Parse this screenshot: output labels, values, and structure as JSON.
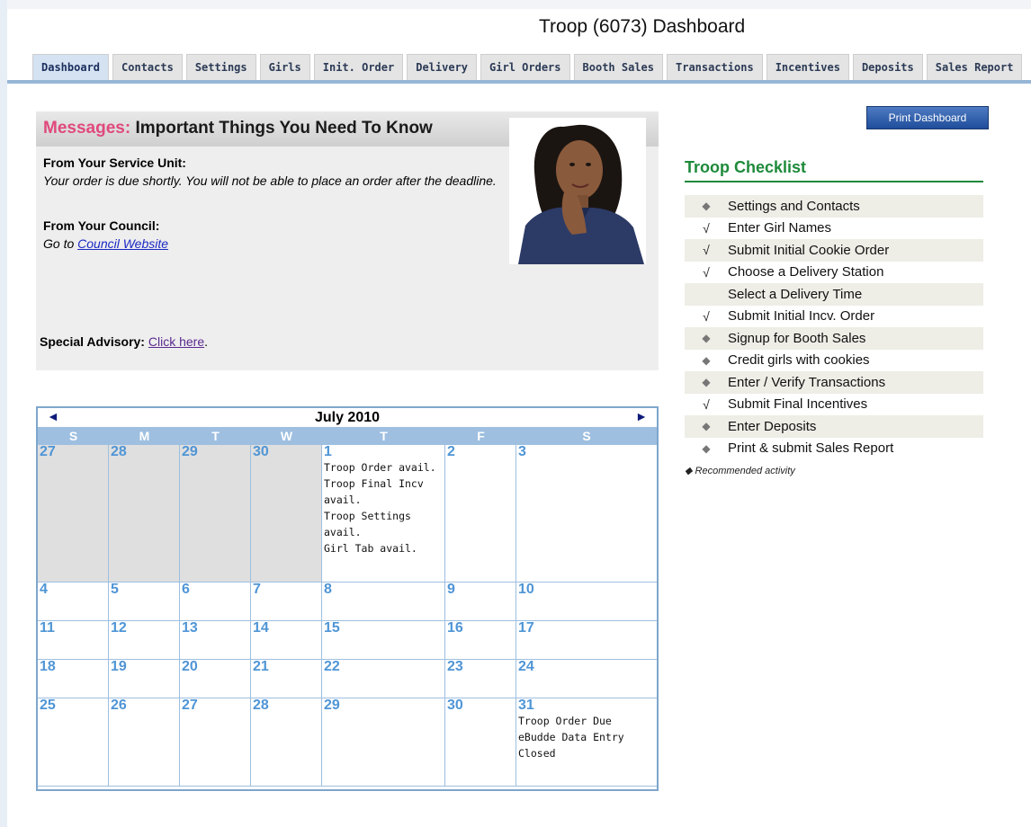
{
  "page_title": "Troop (6073) Dashboard",
  "tabs": [
    "Dashboard",
    "Contacts",
    "Settings",
    "Girls",
    "Init. Order",
    "Delivery",
    "Girl Orders",
    "Booth Sales",
    "Transactions",
    "Incentives",
    "Deposits",
    "Sales Report"
  ],
  "active_tab": "Dashboard",
  "messages": {
    "header_prefix": "Messages:",
    "header_rest": " Important Things You Need To Know",
    "service_unit_label": "From Your Service Unit:",
    "service_unit_text": "Your order is due shortly. You will not be able to place an order after the deadline.",
    "council_label": "From Your Council:",
    "council_prefix": "Go to ",
    "council_link": "Council Website",
    "advisory_label": "Special Advisory:",
    "advisory_link": "Click here",
    "advisory_suffix": "."
  },
  "print_button": "Print Dashboard",
  "checklist": {
    "title": "Troop Checklist",
    "items": [
      {
        "label": "Settings and Contacts",
        "mark": "diamond"
      },
      {
        "label": "Enter Girl Names",
        "mark": "check"
      },
      {
        "label": "Submit Initial Cookie Order",
        "mark": "check"
      },
      {
        "label": "Choose a Delivery Station",
        "mark": "check"
      },
      {
        "label": "Select a Delivery Time",
        "mark": "none"
      },
      {
        "label": "Submit Initial Incv. Order",
        "mark": "check"
      },
      {
        "label": "Signup for Booth Sales",
        "mark": "diamond"
      },
      {
        "label": "Credit girls with cookies",
        "mark": "diamond"
      },
      {
        "label": "Enter / Verify Transactions",
        "mark": "diamond"
      },
      {
        "label": "Submit Final Incentives",
        "mark": "check"
      },
      {
        "label": "Enter Deposits",
        "mark": "diamond"
      },
      {
        "label": "Print & submit Sales Report",
        "mark": "diamond"
      }
    ],
    "note": "◆ Recommended activity"
  },
  "calendar": {
    "month_label": "July 2010",
    "prev_icon": "◄",
    "next_icon": "►",
    "dow": [
      "S",
      "M",
      "T",
      "W",
      "T",
      "F",
      "S"
    ],
    "weeks": [
      [
        {
          "d": "27",
          "other": true
        },
        {
          "d": "28",
          "other": true
        },
        {
          "d": "29",
          "other": true
        },
        {
          "d": "30",
          "other": true
        },
        {
          "d": "1",
          "events": [
            "Troop Order avail.",
            "Troop Final Incv avail.",
            "Troop Settings avail.",
            "Girl Tab avail."
          ]
        },
        {
          "d": "2"
        },
        {
          "d": "3"
        }
      ],
      [
        {
          "d": "4"
        },
        {
          "d": "5"
        },
        {
          "d": "6"
        },
        {
          "d": "7"
        },
        {
          "d": "8"
        },
        {
          "d": "9"
        },
        {
          "d": "10"
        }
      ],
      [
        {
          "d": "11"
        },
        {
          "d": "12"
        },
        {
          "d": "13"
        },
        {
          "d": "14"
        },
        {
          "d": "15"
        },
        {
          "d": "16"
        },
        {
          "d": "17"
        }
      ],
      [
        {
          "d": "18"
        },
        {
          "d": "19"
        },
        {
          "d": "20"
        },
        {
          "d": "21"
        },
        {
          "d": "22"
        },
        {
          "d": "23"
        },
        {
          "d": "24"
        }
      ],
      [
        {
          "d": "25"
        },
        {
          "d": "26"
        },
        {
          "d": "27"
        },
        {
          "d": "28"
        },
        {
          "d": "29"
        },
        {
          "d": "30"
        },
        {
          "d": "31",
          "events": [
            "Troop Order Due",
            "eBudde Data Entry Closed"
          ]
        }
      ]
    ]
  }
}
